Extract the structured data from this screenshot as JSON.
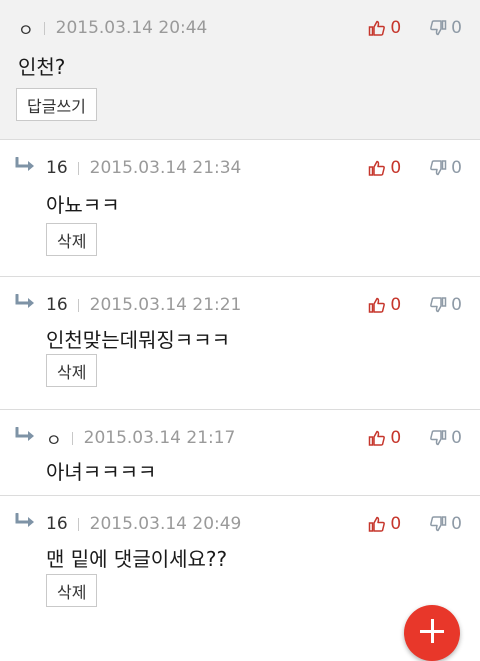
{
  "comments": [
    {
      "author": "ㅇ",
      "time": "2015.03.14 20:44",
      "likes": "0",
      "dislikes": "0",
      "text": "인천?",
      "action": "답글쓰기"
    },
    {
      "author": "16",
      "time": "2015.03.14 21:34",
      "likes": "0",
      "dislikes": "0",
      "text": "아뇨ㅋㅋ",
      "action": "삭제"
    },
    {
      "author": "16",
      "time": "2015.03.14 21:21",
      "likes": "0",
      "dislikes": "0",
      "text": "인천맞는데뭐징ㅋㅋㅋ",
      "action": "삭제"
    },
    {
      "author": "ㅇ",
      "time": "2015.03.14 21:17",
      "likes": "0",
      "dislikes": "0",
      "text": "아녀ㅋㅋㅋㅋ",
      "action": ""
    },
    {
      "author": "16",
      "time": "2015.03.14 20:49",
      "likes": "0",
      "dislikes": "0",
      "text": "맨 밑에 댓글이세요??",
      "action": "삭제"
    }
  ],
  "icons": {
    "reply": "reply-arrow-icon",
    "like": "thumbs-up-icon",
    "dislike": "thumbs-down-icon",
    "fab": "plus-icon"
  },
  "colors": {
    "like": "#c6362c",
    "dislike": "#8e9aa6",
    "fab": "#e8372a",
    "reply_arrow": "#7e93a6"
  }
}
